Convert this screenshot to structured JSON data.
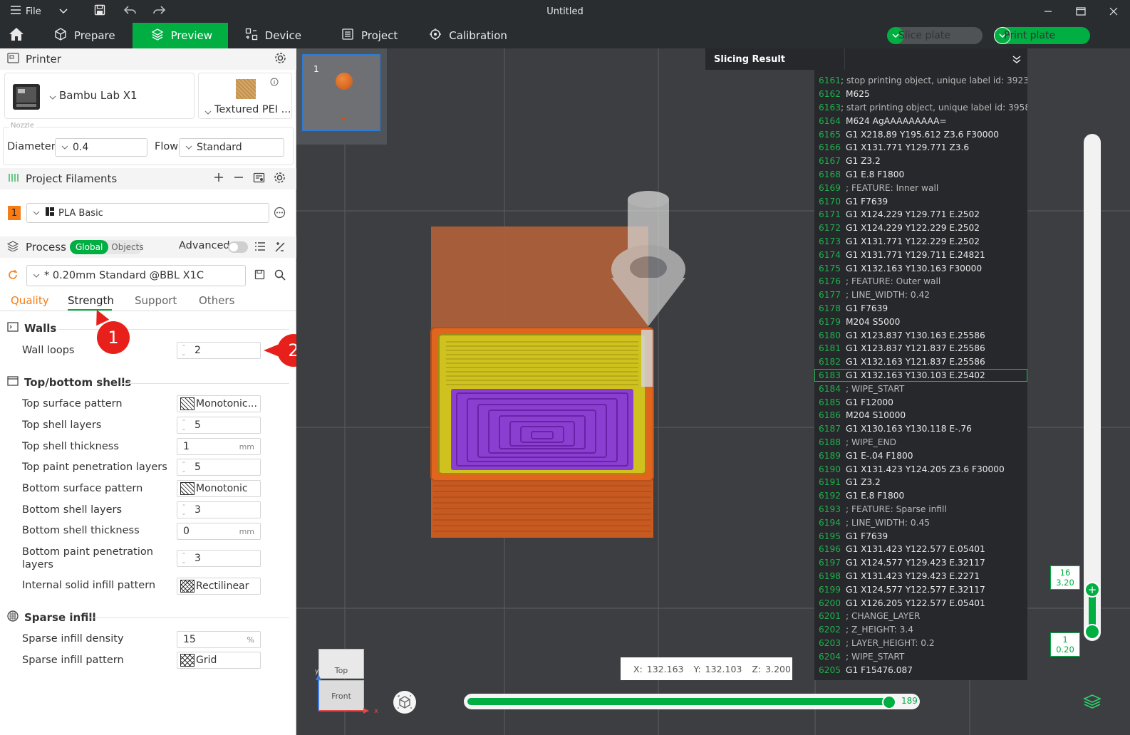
{
  "titlebar": {
    "file_label": "File",
    "title": "Untitled"
  },
  "menu": {
    "tabs": [
      {
        "label": "Prepare"
      },
      {
        "label": "Preview"
      },
      {
        "label": "Device"
      },
      {
        "label": "Project"
      },
      {
        "label": "Calibration"
      }
    ],
    "slice_plate": "Slice plate",
    "print_plate": "Print plate"
  },
  "printer": {
    "section_title": "Printer",
    "printer_name": "Bambu Lab X1",
    "plate_type": "Textured PEI ...",
    "nozzle_label": "Nozzle",
    "diameter_label": "Diameter",
    "diameter_value": "0.4",
    "flow_label": "Flow",
    "flow_value": "Standard"
  },
  "filaments": {
    "section_title": "Project Filaments",
    "slot_number": "1",
    "filament_name": "PLA Basic"
  },
  "process": {
    "section_title": "Process",
    "global_label": "Global",
    "objects_label": "Objects",
    "advanced_label": "Advanced",
    "preset": "* 0.20mm Standard @BBL X1C",
    "tabs": [
      "Quality",
      "Strength",
      "Support",
      "Others"
    ]
  },
  "strength": {
    "walls_title": "Walls",
    "wall_loops_label": "Wall loops",
    "wall_loops_value": "2",
    "shells_title": "Top/bottom shells",
    "rows": [
      {
        "label": "Top surface pattern",
        "value": "Monotonic..."
      },
      {
        "label": "Top shell layers",
        "value": "5"
      },
      {
        "label": "Top shell thickness",
        "value": "1",
        "unit": "mm"
      },
      {
        "label": "Top paint penetration layers",
        "value": "5"
      },
      {
        "label": "Bottom surface pattern",
        "value": "Monotonic"
      },
      {
        "label": "Bottom shell layers",
        "value": "3"
      },
      {
        "label": "Bottom shell thickness",
        "value": "0",
        "unit": "mm"
      },
      {
        "label": "Bottom paint penetration layers",
        "value": "3"
      },
      {
        "label": "Internal solid infill pattern",
        "value": "Rectilinear"
      }
    ],
    "sparse_title": "Sparse infill",
    "sparse_density_label": "Sparse infill density",
    "sparse_density_value": "15",
    "sparse_density_unit": "%",
    "sparse_pattern_label": "Sparse infill pattern",
    "sparse_pattern_value": "Grid"
  },
  "markers": {
    "m1": "1",
    "m2": "2"
  },
  "viewport": {
    "plate_number": "1",
    "slicing_result_title": "Slicing Result",
    "coords": {
      "x_label": "X:",
      "x": "132.163",
      "y_label": "Y:",
      "y": "132.103",
      "z_label": "Z:",
      "z": "3.200"
    },
    "cube_top": "Top",
    "cube_front": "Front",
    "axis_x": "x",
    "axis_y": "y",
    "horizontal_slider_value": "189",
    "horizontal_slider_fraction": 0.94,
    "layer_top": {
      "layer": "16",
      "height": "3.20"
    },
    "layer_bottom": {
      "layer": "1",
      "height": "0.20"
    }
  },
  "gcode": {
    "highlight_line": "6183",
    "lines": [
      {
        "n": "6161",
        "code": "; stop printing object, unique label id: 3923"
      },
      {
        "n": "6162",
        "code": "M625"
      },
      {
        "n": "6163",
        "code": "; start printing object, unique label id: 3958"
      },
      {
        "n": "6164",
        "code": "M624 AgAAAAAAAAA="
      },
      {
        "n": "6165",
        "code": "G1 X218.89 Y195.612 Z3.6 F30000"
      },
      {
        "n": "6166",
        "code": "G1 X131.771 Y129.771 Z3.6"
      },
      {
        "n": "6167",
        "code": "G1 Z3.2"
      },
      {
        "n": "6168",
        "code": "G1 E.8 F1800"
      },
      {
        "n": "6169",
        "code": "; FEATURE: Inner wall"
      },
      {
        "n": "6170",
        "code": "G1 F7639"
      },
      {
        "n": "6171",
        "code": "G1 X124.229 Y129.771 E.2502"
      },
      {
        "n": "6172",
        "code": "G1 X124.229 Y122.229 E.2502"
      },
      {
        "n": "6173",
        "code": "G1 X131.771 Y122.229 E.2502"
      },
      {
        "n": "6174",
        "code": "G1 X131.771 Y129.711 E.24821"
      },
      {
        "n": "6175",
        "code": "G1 X132.163 Y130.163 F30000"
      },
      {
        "n": "6176",
        "code": "; FEATURE: Outer wall"
      },
      {
        "n": "6177",
        "code": "; LINE_WIDTH: 0.42"
      },
      {
        "n": "6178",
        "code": "G1 F7639"
      },
      {
        "n": "6179",
        "code": "M204 S5000"
      },
      {
        "n": "6180",
        "code": "G1 X123.837 Y130.163 E.25586"
      },
      {
        "n": "6181",
        "code": "G1 X123.837 Y121.837 E.25586"
      },
      {
        "n": "6182",
        "code": "G1 X132.163 Y121.837 E.25586"
      },
      {
        "n": "6183",
        "code": "G1 X132.163 Y130.103 E.25402"
      },
      {
        "n": "6184",
        "code": "; WIPE_START"
      },
      {
        "n": "6185",
        "code": "G1 F12000"
      },
      {
        "n": "6186",
        "code": "M204 S10000"
      },
      {
        "n": "6187",
        "code": "G1 X130.163 Y130.118 E-.76"
      },
      {
        "n": "6188",
        "code": "; WIPE_END"
      },
      {
        "n": "6189",
        "code": "G1 E-.04 F1800"
      },
      {
        "n": "6190",
        "code": "G1 X131.423 Y124.205 Z3.6 F30000"
      },
      {
        "n": "6191",
        "code": "G1 Z3.2"
      },
      {
        "n": "6192",
        "code": "G1 E.8 F1800"
      },
      {
        "n": "6193",
        "code": "; FEATURE: Sparse infill"
      },
      {
        "n": "6194",
        "code": "; LINE_WIDTH: 0.45"
      },
      {
        "n": "6195",
        "code": "G1 F7639"
      },
      {
        "n": "6196",
        "code": "G1 X131.423 Y122.577 E.05401"
      },
      {
        "n": "6197",
        "code": "G1 X124.577 Y129.423 E.32117"
      },
      {
        "n": "6198",
        "code": "G1 X131.423 Y129.423 E.2271"
      },
      {
        "n": "6199",
        "code": "G1 X124.577 Y122.577 E.32117"
      },
      {
        "n": "6200",
        "code": "G1 X126.205 Y122.577 E.05401"
      },
      {
        "n": "6201",
        "code": "; CHANGE_LAYER"
      },
      {
        "n": "6202",
        "code": "; Z_HEIGHT: 3.4"
      },
      {
        "n": "6203",
        "code": "; LAYER_HEIGHT: 0.2"
      },
      {
        "n": "6204",
        "code": "; WIPE_START"
      },
      {
        "n": "6205",
        "code": "G1 F15476.087"
      }
    ]
  },
  "colors": {
    "accent": "#00ae42",
    "marker": "#e8201c",
    "filament": "#f57c16",
    "wall_outer": "#e0661d",
    "wall_inner": "#cfc21e",
    "top_surface": "#8a3fd0"
  }
}
